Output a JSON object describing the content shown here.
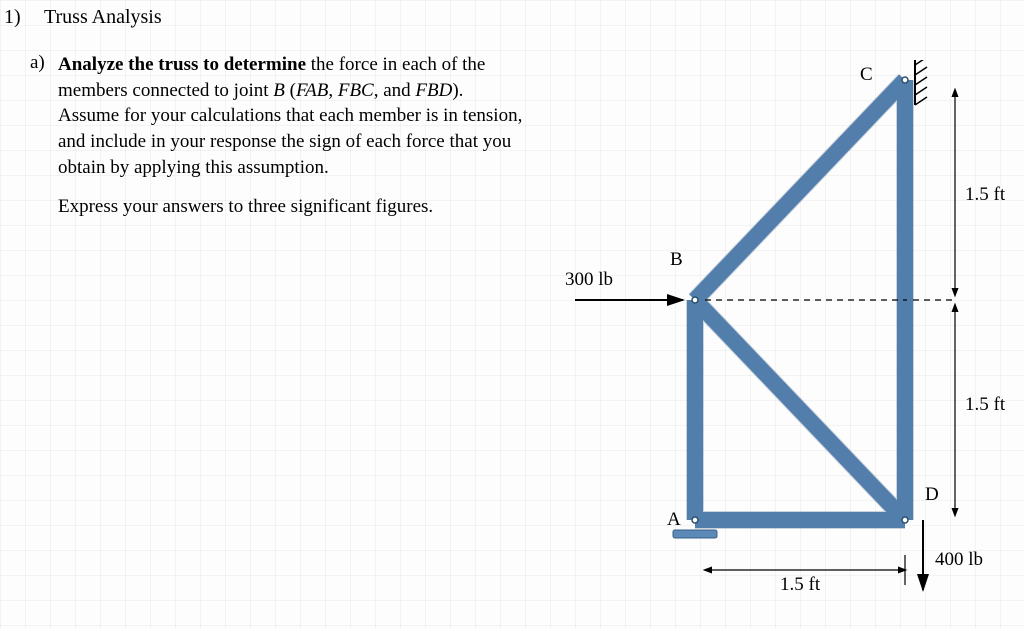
{
  "question": {
    "number": "1)",
    "title": "Truss Analysis",
    "sub_letter": "a)",
    "instruction_bold": "Analyze the truss to determine",
    "instruction_rest": " the force in each of the members connected to joint ",
    "joint_ref": "B",
    "forces_paren_open": " (",
    "force1": "FAB",
    "sep1": ", ",
    "force2": "FBC",
    "sep2": ", and ",
    "force3": "FBD",
    "forces_paren_close": ").",
    "assumption": "  Assume for your calculations that each member is in tension, and include in your response the sign of each force that you obtain by applying this assumption.",
    "express": "Express your answers to three significant figures."
  },
  "diagram": {
    "labels": {
      "A": "A",
      "B": "B",
      "C": "C",
      "D": "D"
    },
    "load_left": "300 lb",
    "load_down": "400 lb",
    "dim_h": "1.5 ft",
    "dim_v_top": "1.5 ft",
    "dim_v_bot": "1.5 ft"
  },
  "chart_data": {
    "type": "diagram",
    "description": "Plane truss with joints A (pin support, bottom-left), B (mid-left height), C (top-right), D (bottom-right). Members: AB vertical, BC diagonal up-right, BD diagonal down-right, CD vertical, AD horizontal. 300 lb horizontal load applied rightward at B. 400 lb vertical downward load applied at D.",
    "joints": {
      "A": {
        "x": 0.0,
        "y": 0.0,
        "support": "pin"
      },
      "B": {
        "x": 0.0,
        "y": 1.5
      },
      "C": {
        "x": 1.5,
        "y": 3.0
      },
      "D": {
        "x": 1.5,
        "y": 0.0
      }
    },
    "members": [
      "AB",
      "BC",
      "BD",
      "CD",
      "AD"
    ],
    "loads": [
      {
        "joint": "B",
        "fx": 300,
        "fy": 0,
        "unit": "lb"
      },
      {
        "joint": "D",
        "fx": 0,
        "fy": -400,
        "unit": "lb"
      }
    ],
    "dimensions": {
      "AD": 1.5,
      "AB": 1.5,
      "CD_upper_half": 1.5,
      "unit": "ft"
    }
  }
}
